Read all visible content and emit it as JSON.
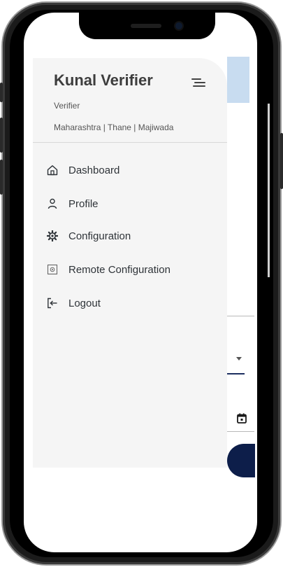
{
  "drawer": {
    "user_name": "Kunal Verifier",
    "user_role": "Verifier",
    "user_location": "Maharashtra | Thane | Majiwada",
    "items": [
      {
        "label": "Dashboard",
        "icon": "home-icon"
      },
      {
        "label": "Profile",
        "icon": "person-icon"
      },
      {
        "label": "Configuration",
        "icon": "gear-icon"
      },
      {
        "label": "Remote Configuration",
        "icon": "remote-settings-icon"
      },
      {
        "label": "Logout",
        "icon": "logout-icon"
      }
    ]
  },
  "colors": {
    "drawer_bg": "#f5f5f5",
    "header_bg": "#c8dcf0",
    "primary_button": "#0d1e4a",
    "text": "#2e3338"
  }
}
